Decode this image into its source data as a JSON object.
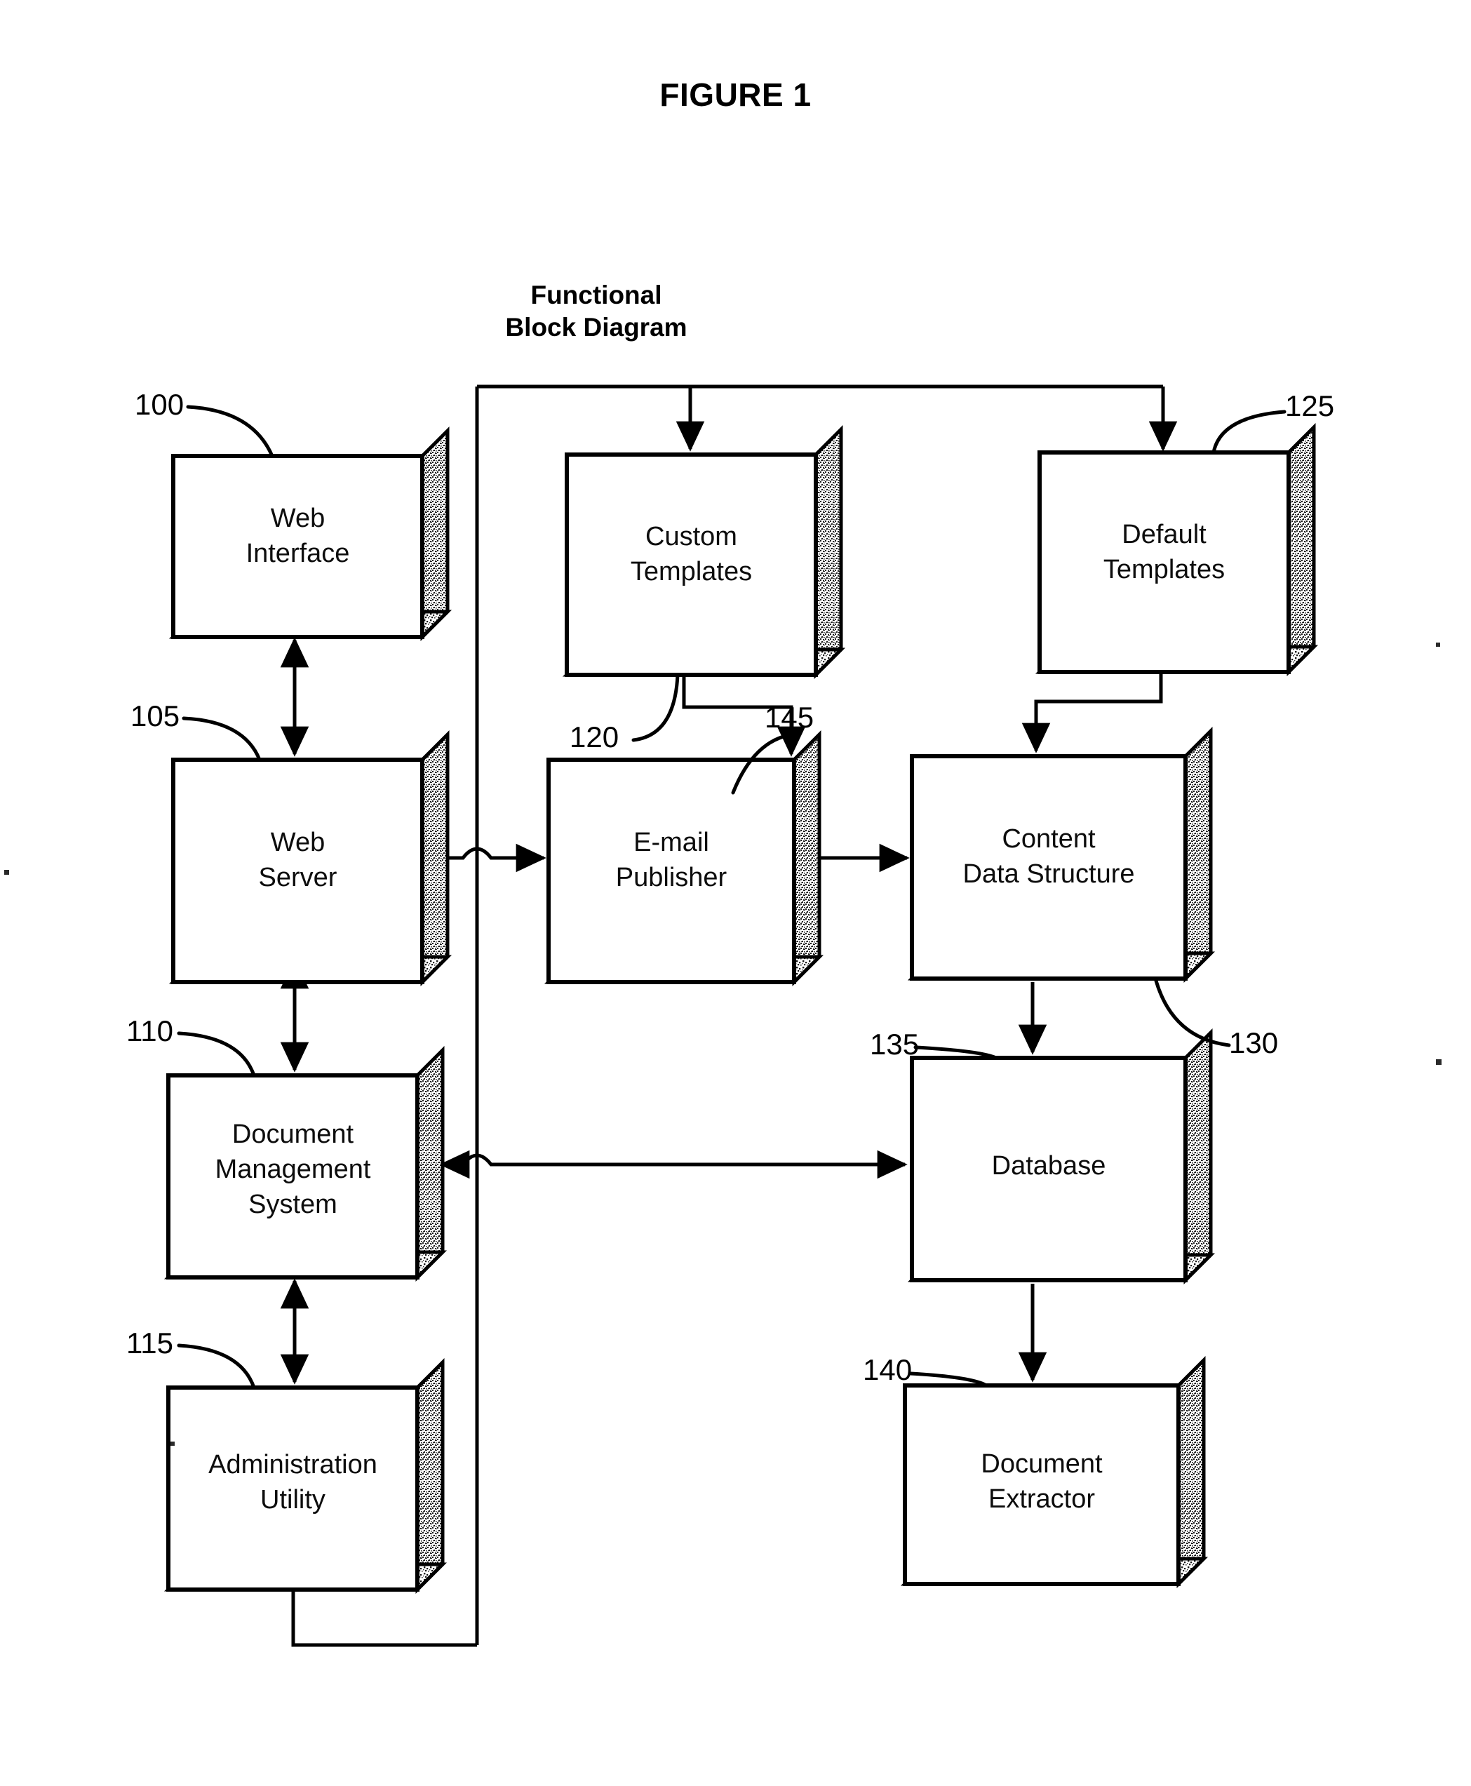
{
  "figure": {
    "title": "FIGURE 1",
    "subtitle_line1": "Functional",
    "subtitle_line2": "Block Diagram"
  },
  "colors": {
    "ink": "#000000",
    "paper": "#ffffff",
    "shadow_fill": "#d9d9d9"
  },
  "blocks": [
    {
      "id": "web-interface",
      "ref": "100",
      "line1": "Web",
      "line2": "Interface",
      "line3": ""
    },
    {
      "id": "custom-templates",
      "ref": "120",
      "line1": "Custom",
      "line2": "Templates",
      "line3": ""
    },
    {
      "id": "default-templates",
      "ref": "125",
      "line1": "Default",
      "line2": "Templates",
      "line3": ""
    },
    {
      "id": "web-server",
      "ref": "105",
      "line1": "Web",
      "line2": "Server",
      "line3": ""
    },
    {
      "id": "email-publisher",
      "ref": "145",
      "line1": "E-mail",
      "line2": "Publisher",
      "line3": ""
    },
    {
      "id": "content-data",
      "ref": "130",
      "line1": "Content",
      "line2": "Data Structure",
      "line3": ""
    },
    {
      "id": "dms",
      "ref": "110",
      "line1": "Document",
      "line2": "Management",
      "line3": "System"
    },
    {
      "id": "database",
      "ref": "135",
      "line1": "Database",
      "line2": "",
      "line3": ""
    },
    {
      "id": "admin-utility",
      "ref": "115",
      "line1": "Administration",
      "line2": "Utility",
      "line3": ""
    },
    {
      "id": "doc-extractor",
      "ref": "140",
      "line1": "Document",
      "line2": "Extractor",
      "line3": ""
    }
  ],
  "reference_numerals": {
    "web_interface": "100",
    "web_server": "105",
    "dms": "110",
    "admin_utility": "115",
    "custom_templates": "120",
    "default_templates": "125",
    "content_data_structure": "130",
    "database": "135",
    "document_extractor": "140",
    "email_publisher": "145"
  },
  "chart_data": {
    "type": "diagram",
    "title": "Functional Block Diagram",
    "nodes": [
      {
        "ref": "100",
        "label": "Web Interface"
      },
      {
        "ref": "105",
        "label": "Web Server"
      },
      {
        "ref": "110",
        "label": "Document Management System"
      },
      {
        "ref": "115",
        "label": "Administration Utility"
      },
      {
        "ref": "120",
        "label": "Custom Templates"
      },
      {
        "ref": "125",
        "label": "Default Templates"
      },
      {
        "ref": "130",
        "label": "Content Data Structure"
      },
      {
        "ref": "135",
        "label": "Database"
      },
      {
        "ref": "140",
        "label": "Document Extractor"
      },
      {
        "ref": "145",
        "label": "E-mail Publisher"
      }
    ],
    "edges": [
      {
        "from": "100",
        "to": "105",
        "direction": "bidirectional"
      },
      {
        "from": "105",
        "to": "110",
        "direction": "bidirectional"
      },
      {
        "from": "110",
        "to": "115",
        "direction": "bidirectional"
      },
      {
        "from": "105",
        "to": "145",
        "direction": "forward"
      },
      {
        "from": "145",
        "to": "130",
        "direction": "forward"
      },
      {
        "from": "120",
        "to": "145",
        "direction": "forward"
      },
      {
        "from": "125",
        "to": "130",
        "direction": "forward"
      },
      {
        "from": "130",
        "to": "135",
        "direction": "forward"
      },
      {
        "from": "110",
        "to": "135",
        "direction": "bidirectional"
      },
      {
        "from": "135",
        "to": "140",
        "direction": "forward"
      },
      {
        "from": "115",
        "to": "120",
        "direction": "forward"
      },
      {
        "from": "115",
        "to": "125",
        "direction": "forward"
      }
    ]
  }
}
